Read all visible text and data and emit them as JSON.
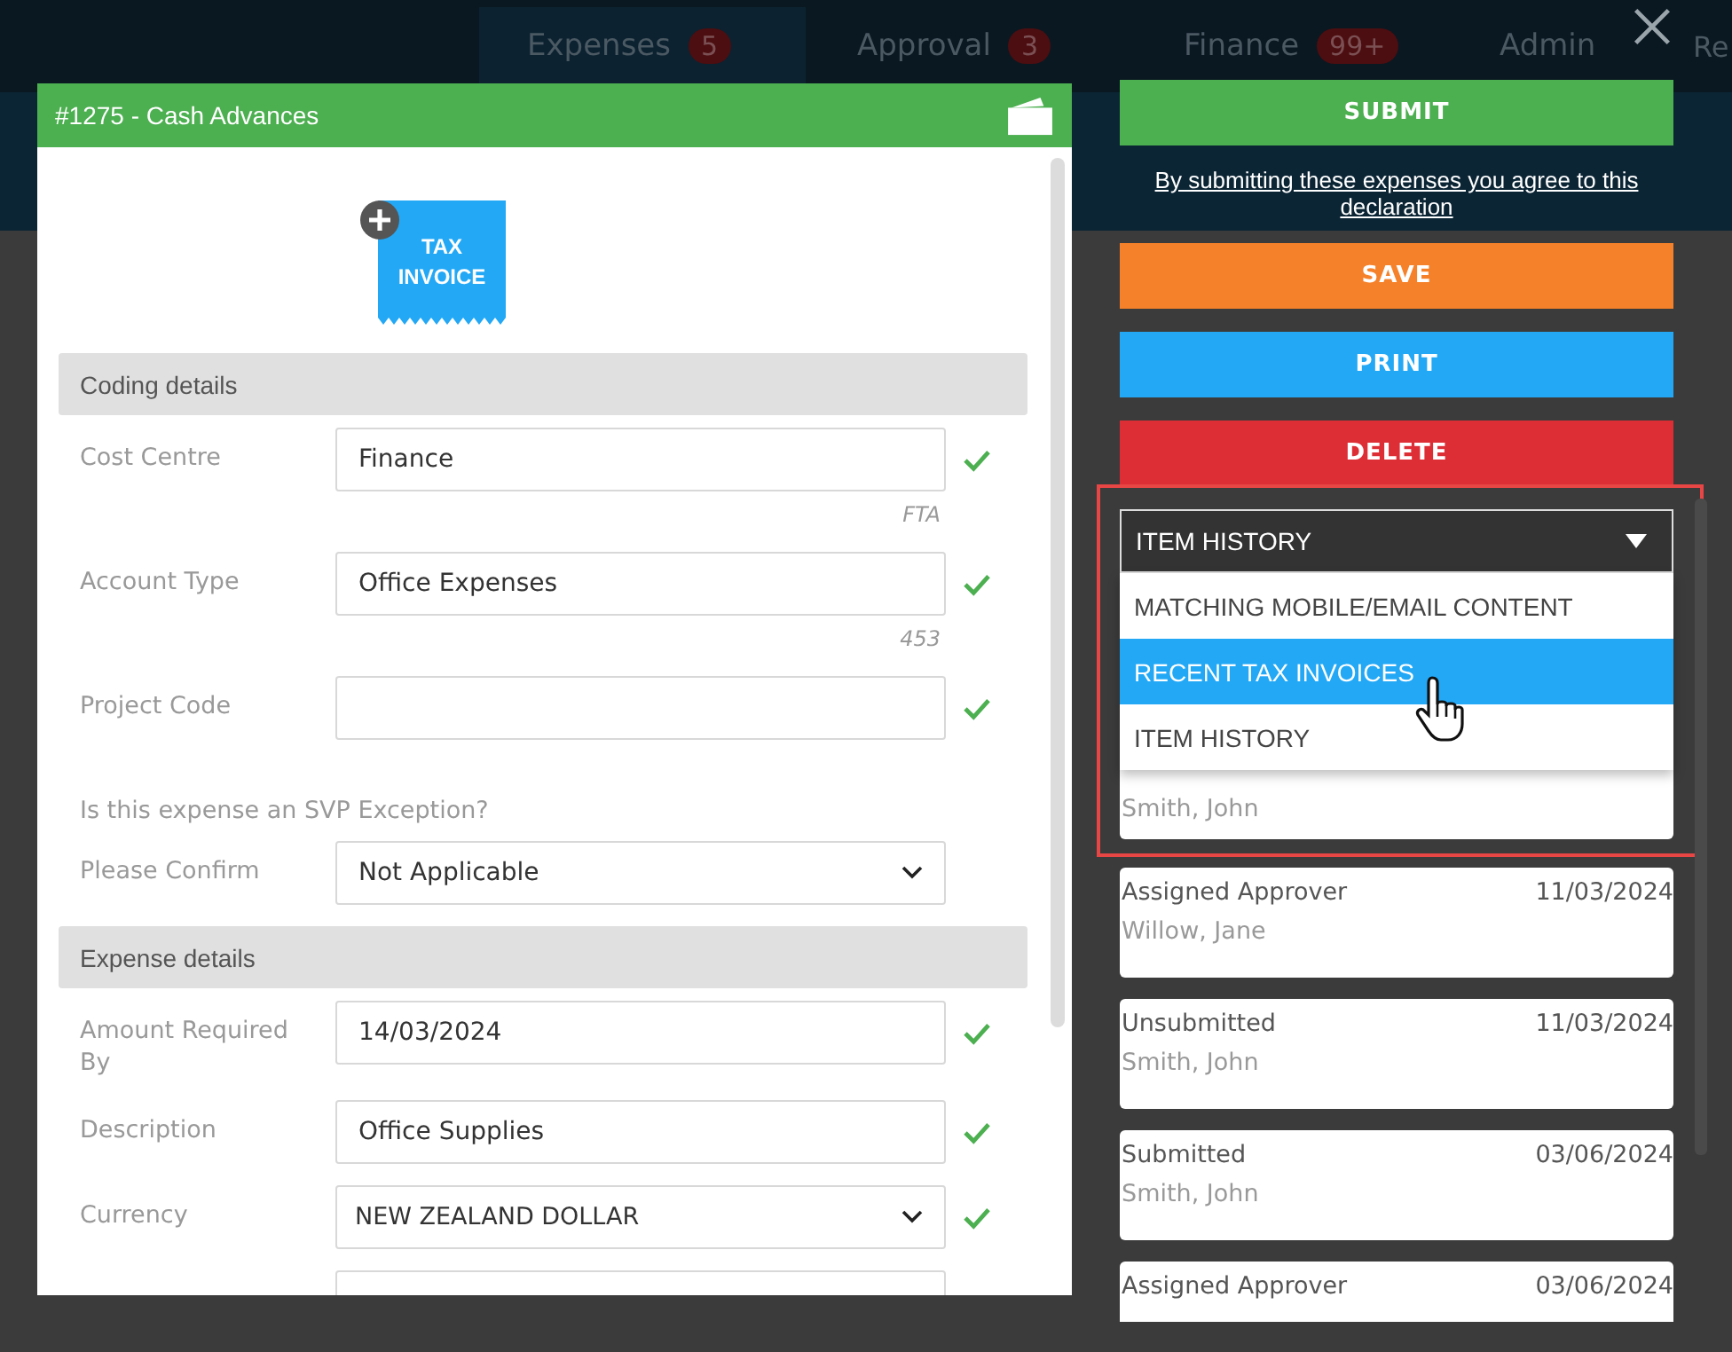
{
  "nav": {
    "tabs": [
      {
        "label": "Expenses",
        "count": "5",
        "selected": true
      },
      {
        "label": "Approval",
        "count": "3",
        "selected": false
      },
      {
        "label": "Finance",
        "count": "99+",
        "selected": false
      },
      {
        "label": "Admin",
        "selected": false
      },
      {
        "label": "Re",
        "selected": false
      }
    ]
  },
  "dialog": {
    "title": "#1275 - Cash Advances",
    "attachment": {
      "line1": "TAX",
      "line2": "INVOICE"
    },
    "sections": [
      {
        "heading": "Coding details",
        "fields": [
          {
            "kind": "text",
            "label": "Cost Centre",
            "value": "Finance",
            "hint": "FTA",
            "valid": true
          },
          {
            "kind": "text",
            "label": "Account Type",
            "value": "Office Expenses",
            "hint": "453",
            "valid": true
          },
          {
            "kind": "text",
            "label": "Project Code",
            "valid": true
          },
          {
            "kind": "question",
            "label": "Is this expense an SVP Exception?"
          },
          {
            "kind": "select",
            "label": "Please Confirm",
            "value": "Not Applicable"
          }
        ]
      },
      {
        "heading": "Expense details",
        "fields": [
          {
            "kind": "text",
            "label": "Amount Required By",
            "value": "14/03/2024",
            "valid": true
          },
          {
            "kind": "text",
            "label": "Description",
            "value": "Office Supplies",
            "valid": true
          },
          {
            "kind": "select",
            "label": "Currency",
            "value": "NEW ZEALAND DOLLAR",
            "valid": true
          },
          {
            "kind": "text"
          }
        ]
      }
    ]
  },
  "panel": {
    "actions": [
      {
        "kind": "button",
        "label": "SUBMIT",
        "color": "#4caf50"
      },
      {
        "kind": "link",
        "label": "By submitting these expenses you agree to this declaration"
      },
      {
        "kind": "button",
        "label": "SAVE",
        "color": "#f5812a"
      },
      {
        "kind": "button",
        "label": "PRINT",
        "color": "#23a8f6"
      },
      {
        "kind": "button",
        "label": "DELETE",
        "color": "#dd2e36"
      }
    ],
    "dropdown": {
      "value": "ITEM HISTORY",
      "options": [
        {
          "label": "MATCHING MOBILE/EMAIL CONTENT",
          "highlighted": false
        },
        {
          "label": "RECENT TAX INVOICES",
          "highlighted": true
        },
        {
          "label": "ITEM HISTORY",
          "highlighted": false
        }
      ]
    },
    "history": [
      {
        "person": "Smith, John"
      },
      {
        "status": "Assigned Approver",
        "date": "11/03/2024",
        "person": "Willow, Jane"
      },
      {
        "status": "Unsubmitted",
        "date": "11/03/2024",
        "person": "Smith, John"
      },
      {
        "status": "Submitted",
        "date": "03/06/2024",
        "person": "Smith, John"
      },
      {
        "status": "Assigned Approver",
        "date": "03/06/2024"
      }
    ]
  }
}
